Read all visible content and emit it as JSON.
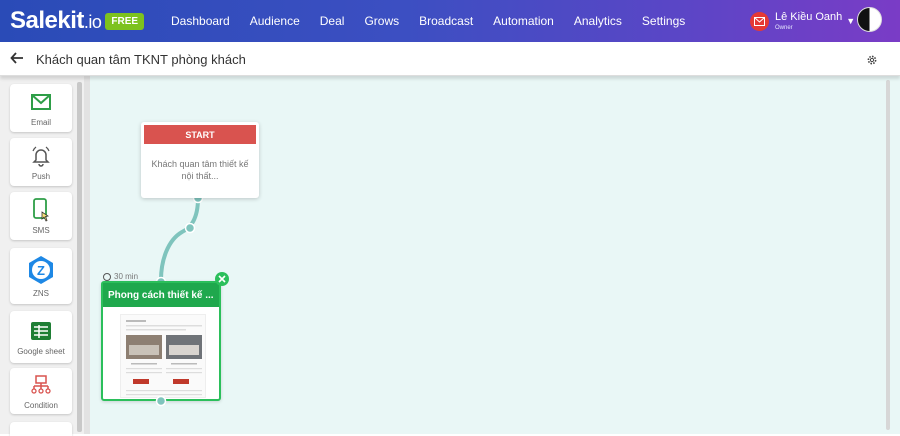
{
  "brand": {
    "logo_main": "Salekit",
    "logo_suffix": ".io",
    "badge": "FREE"
  },
  "nav": [
    "Dashboard",
    "Audience",
    "Deal",
    "Grows",
    "Broadcast",
    "Automation",
    "Analytics",
    "Settings"
  ],
  "user": {
    "name": "Lê Kiều Oanh",
    "role": "Owner"
  },
  "page": {
    "title": "Khách quan tâm TKNT phòng khách"
  },
  "tools": [
    "Email",
    "Push",
    "SMS",
    "ZNS",
    "Google sheet",
    "Condition"
  ],
  "flow": {
    "start": {
      "label": "START",
      "description": "Khách quan tâm thiết kế nội thất..."
    },
    "delay": "30 min",
    "email_node": {
      "title": "Phong cách thiết kế ..."
    }
  },
  "colors": {
    "accent_green": "#1fa84d",
    "start_red": "#d9534f",
    "connector": "#7fc4bd"
  }
}
